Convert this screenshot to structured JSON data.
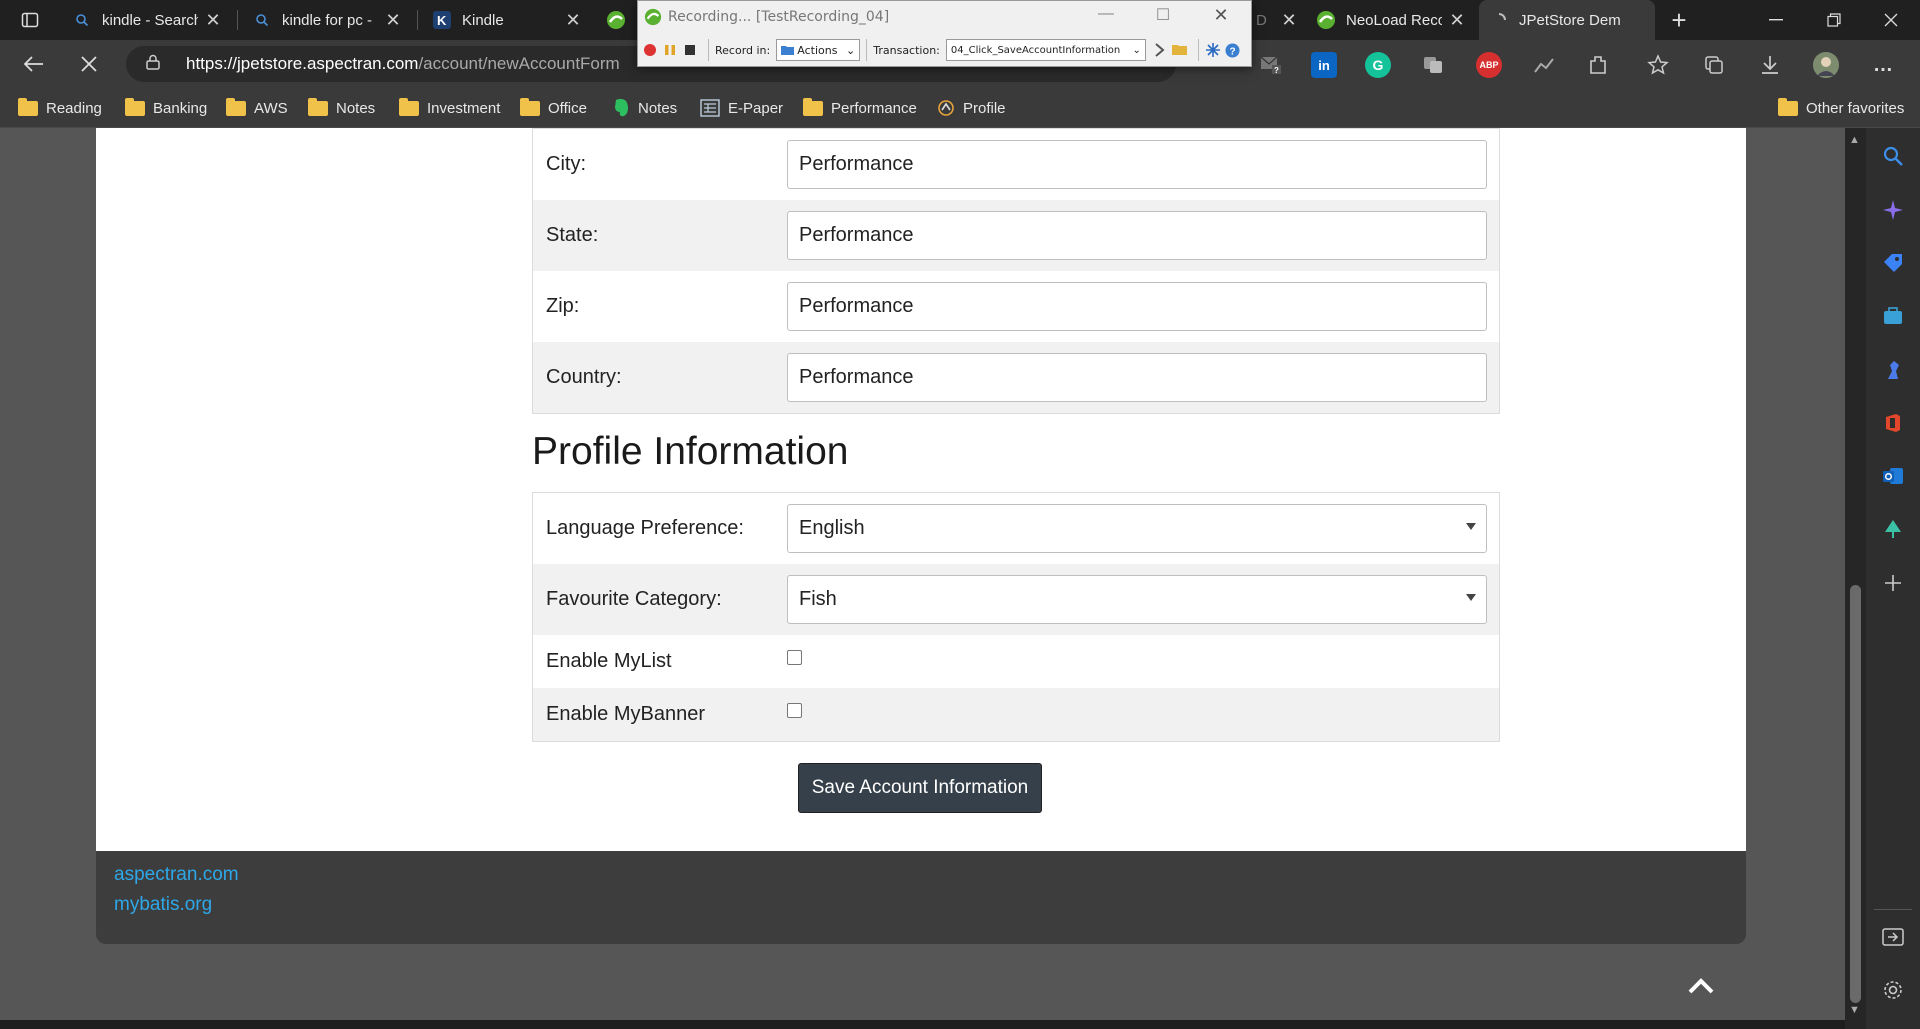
{
  "tabs": [
    {
      "title": "kindle - Search",
      "icon": "search-icon"
    },
    {
      "title": "kindle for pc -",
      "icon": "search-icon"
    },
    {
      "title": "Kindle",
      "icon": "kindle-icon"
    },
    {
      "title": "D",
      "icon": "neoload-icon"
    },
    {
      "title": "NeoLoad Reco",
      "icon": "neoload-icon"
    },
    {
      "title": "JPetStore Dem",
      "icon": "loading-icon",
      "active": true
    }
  ],
  "address_bar": {
    "url_host": "https://jpetstore.aspectran.com",
    "url_path": "/account/newAccountForm"
  },
  "extensions": [
    {
      "name": "mail-icon",
      "label": "?"
    },
    {
      "name": "linkedin-icon",
      "label": "in"
    },
    {
      "name": "grammarly-icon",
      "label": "G"
    },
    {
      "name": "translate-icon",
      "label": ""
    },
    {
      "name": "adblock-icon",
      "label": "ABP"
    },
    {
      "name": "stats-icon",
      "label": ""
    },
    {
      "name": "extensions-icon",
      "label": ""
    },
    {
      "name": "favorites-icon",
      "label": ""
    },
    {
      "name": "collections-icon",
      "label": ""
    },
    {
      "name": "downloads-icon",
      "label": ""
    },
    {
      "name": "profile-avatar",
      "label": ""
    },
    {
      "name": "more-icon",
      "label": "…"
    }
  ],
  "favorites": [
    {
      "label": "Reading",
      "icon": "folder-icon"
    },
    {
      "label": "Banking",
      "icon": "folder-icon"
    },
    {
      "label": "AWS",
      "icon": "folder-icon"
    },
    {
      "label": "Notes",
      "icon": "folder-icon"
    },
    {
      "label": "Investment",
      "icon": "folder-icon"
    },
    {
      "label": "Office",
      "icon": "folder-icon"
    },
    {
      "label": "Notes",
      "icon": "evernote-icon"
    },
    {
      "label": "E-Paper",
      "icon": "newspaper-icon"
    },
    {
      "label": "Performance",
      "icon": "folder-icon"
    },
    {
      "label": "Profile",
      "icon": "profile-icon"
    }
  ],
  "other_favorites": "Other favorites",
  "recorder": {
    "title": "Recording... [TestRecording_04]",
    "record_in_label": "Record in:",
    "record_in_value": "Actions",
    "transaction_label": "Transaction:",
    "transaction_value": "04_Click_SaveAccountInformation"
  },
  "form": {
    "address_rows": [
      {
        "label": "City:",
        "value": "Performance"
      },
      {
        "label": "State:",
        "value": "Performance"
      },
      {
        "label": "Zip:",
        "value": "Performance"
      },
      {
        "label": "Country:",
        "value": "Performance"
      }
    ],
    "profile_title": "Profile Information",
    "language_label": "Language Preference:",
    "language_value": "English",
    "category_label": "Favourite Category:",
    "category_value": "Fish",
    "mylist_label": "Enable MyList",
    "mylist_checked": false,
    "mybanner_label": "Enable MyBanner",
    "mybanner_checked": false,
    "save_label": "Save Account Information"
  },
  "footer": {
    "link1": "aspectran.com",
    "link2": "mybatis.org"
  },
  "colors": {
    "link": "#2ea7e8",
    "save_button": "#36404a",
    "footer_bg": "#3d3d3d"
  }
}
